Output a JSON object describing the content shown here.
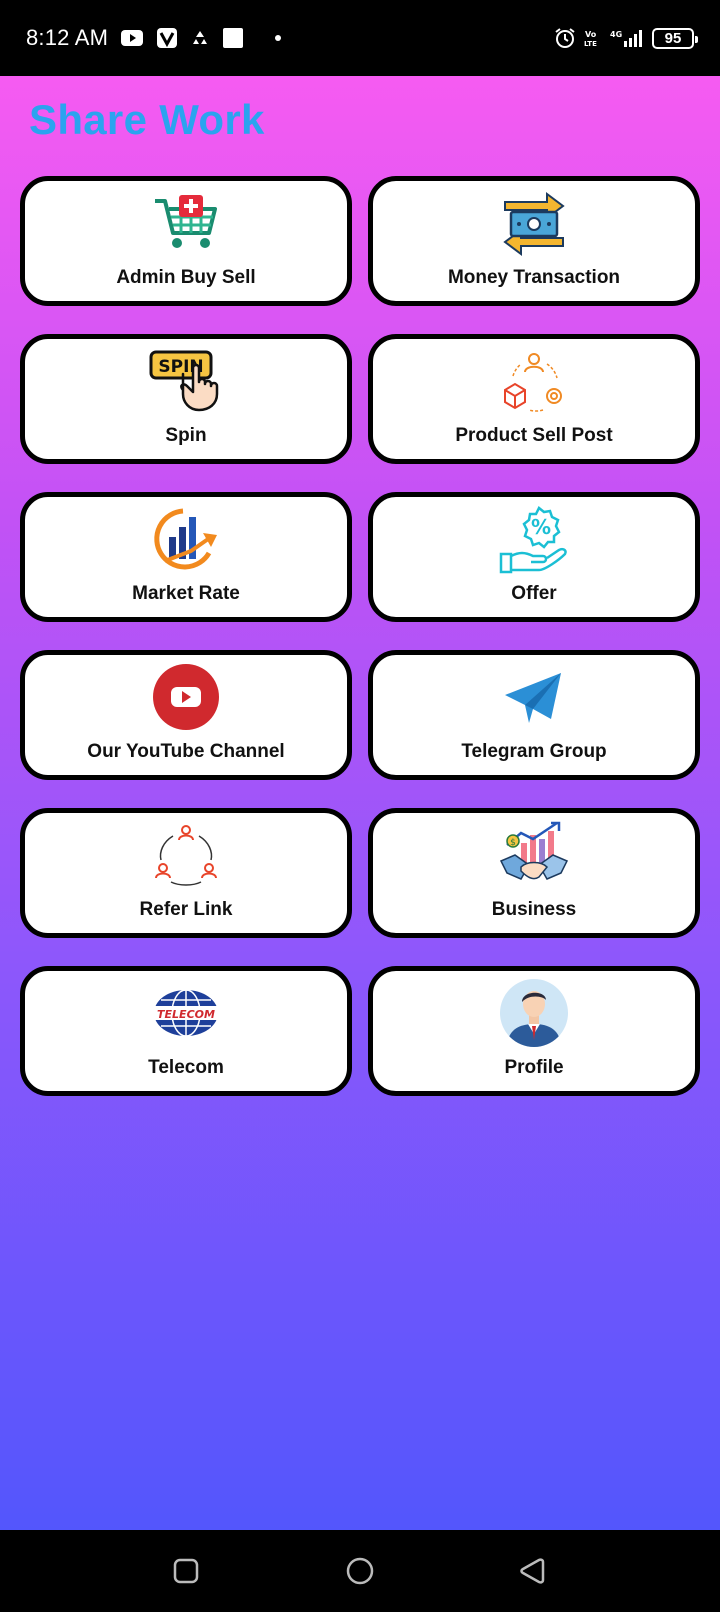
{
  "status_bar": {
    "time": "8:12 AM",
    "battery": "95",
    "icons": [
      "youtube-icon",
      "v-app-icon",
      "recycle-icon",
      "square-notification-icon",
      "dot-icon",
      "alarm-icon",
      "volte-icon",
      "4g-signal-icon",
      "battery-icon"
    ]
  },
  "app": {
    "title": "Share Work",
    "title_color": "#2ba3ef"
  },
  "cards": [
    {
      "label": "Admin Buy Sell",
      "icon": "shopping-cart-icon"
    },
    {
      "label": "Money Transaction",
      "icon": "money-transfer-icon"
    },
    {
      "label": "Spin",
      "icon": "spin-button-icon"
    },
    {
      "label": "Product Sell Post",
      "icon": "product-cycle-icon"
    },
    {
      "label": "Market Rate",
      "icon": "market-chart-icon"
    },
    {
      "label": "Offer",
      "icon": "discount-hand-icon"
    },
    {
      "label": "Our YouTube Channel",
      "icon": "youtube-play-icon"
    },
    {
      "label": "Telegram Group",
      "icon": "telegram-icon"
    },
    {
      "label": "Refer Link",
      "icon": "refer-network-icon"
    },
    {
      "label": "Business",
      "icon": "handshake-growth-icon"
    },
    {
      "label": "Telecom",
      "icon": "telecom-globe-icon"
    },
    {
      "label": "Profile",
      "icon": "user-avatar-icon"
    }
  ],
  "nav_bar": {
    "buttons": [
      "recent-apps-icon",
      "home-icon",
      "back-icon"
    ]
  }
}
